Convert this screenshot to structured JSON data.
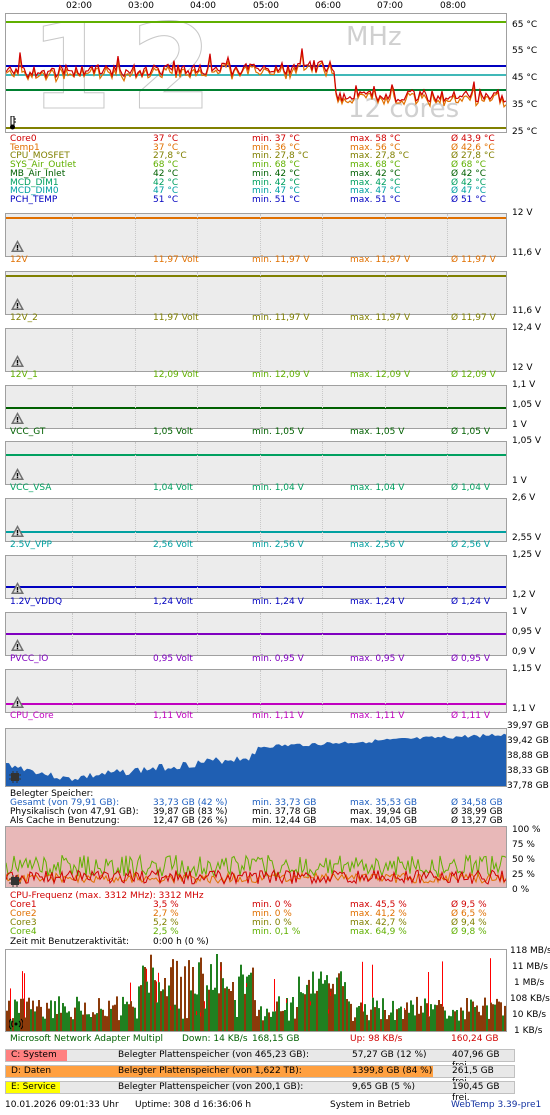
{
  "time_labels": [
    "02:00",
    "03:00",
    "04:00",
    "05:00",
    "06:00",
    "07:00",
    "08:00"
  ],
  "temp_panel": {
    "watermark_left": "12",
    "watermark_mhz": "MHz",
    "watermark_cores": "12 cores",
    "y_labels": [
      "65 °C",
      "55 °C",
      "45 °C",
      "35 °C",
      "25 °C"
    ],
    "rows": [
      {
        "name": "Core0",
        "cur": "37 °C",
        "min": "min. 37 °C",
        "max": "max. 58 °C",
        "avg": "Ø 43,9 °C",
        "color": "#d00000"
      },
      {
        "name": "Temp1",
        "cur": "37 °C",
        "min": "min. 36 °C",
        "max": "max. 56 °C",
        "avg": "Ø 42,6 °C",
        "color": "#e07000"
      },
      {
        "name": "CPU_MOSFET",
        "cur": "27,8 °C",
        "min": "min. 27,8 °C",
        "max": "max. 27,8 °C",
        "avg": "Ø 27,8 °C",
        "color": "#808000"
      },
      {
        "name": "SYS_Air_Outlet",
        "cur": "68 °C",
        "min": "min. 68 °C",
        "max": "max. 68 °C",
        "avg": "Ø 68 °C",
        "color": "#60b000"
      },
      {
        "name": "MB_Air_Inlet",
        "cur": "42 °C",
        "min": "min. 42 °C",
        "max": "max. 42 °C",
        "avg": "Ø 42 °C",
        "color": "#006000"
      },
      {
        "name": "MCD_DIM1",
        "cur": "42 °C",
        "min": "min. 42 °C",
        "max": "max. 42 °C",
        "avg": "Ø 42 °C",
        "color": "#00a060"
      },
      {
        "name": "MCD_DIM0",
        "cur": "47 °C",
        "min": "min. 47 °C",
        "max": "max. 47 °C",
        "avg": "Ø 47 °C",
        "color": "#00a0a0"
      },
      {
        "name": "PCH_TEMP",
        "cur": "51 °C",
        "min": "min. 51 °C",
        "max": "max. 51 °C",
        "avg": "Ø 51 °C",
        "color": "#0000c0"
      }
    ]
  },
  "volt_panels": [
    {
      "name": "12V",
      "cur": "11,97 Volt",
      "min": "min. 11,97 V",
      "max": "max. 11,97 V",
      "avg": "Ø 11,97 V",
      "color": "#e07000",
      "ytop": "12 V",
      "ybot": "11,6 V"
    },
    {
      "name": "12V_2",
      "cur": "11,97 Volt",
      "min": "min. 11,97 V",
      "max": "max. 11,97 V",
      "avg": "Ø 11,97 V",
      "color": "#808000",
      "ytop": "",
      "ybot": "11,6 V"
    },
    {
      "name": "12V_1",
      "cur": "12,09 Volt",
      "min": "min. 12,09 V",
      "max": "max. 12,09 V",
      "avg": "Ø 12,09 V",
      "color": "#60b000",
      "ytop": "12,4 V",
      "ybot": "12 V"
    },
    {
      "name": "VCC_GT",
      "cur": "1,05 Volt",
      "min": "min. 1,05 V",
      "max": "max. 1,05 V",
      "avg": "Ø 1,05 V",
      "color": "#006000",
      "ytop": "1,1 V",
      "ymid": "1,05 V",
      "ybot": "1 V"
    },
    {
      "name": "VCC_VSA",
      "cur": "1,04 Volt",
      "min": "min. 1,04 V",
      "max": "max. 1,04 V",
      "avg": "Ø 1,04 V",
      "color": "#00a060",
      "ytop": "1,05 V",
      "ybot": "1 V"
    },
    {
      "name": "2.5V_VPP",
      "cur": "2,56 Volt",
      "min": "min. 2,56 V",
      "max": "max. 2,56 V",
      "avg": "Ø 2,56 V",
      "color": "#00a0a0",
      "ytop": "2,6 V",
      "ybot": "2,55 V"
    },
    {
      "name": "1.2V_VDDQ",
      "cur": "1,24 Volt",
      "min": "min. 1,24 V",
      "max": "max. 1,24 V",
      "avg": "Ø 1,24 V",
      "color": "#0000c0",
      "ytop": "1,25 V",
      "ybot": "1,2 V"
    },
    {
      "name": "PVCC_IO",
      "cur": "0,95 Volt",
      "min": "min. 0,95 V",
      "max": "max. 0,95 V",
      "avg": "Ø 0,95 V",
      "color": "#8000c0",
      "ytop": "1 V",
      "ymid": "0,95 V",
      "ybot": "0,9 V"
    },
    {
      "name": "CPU_Core",
      "cur": "1,11 Volt",
      "min": "min. 1,11 V",
      "max": "max. 1,11 V",
      "avg": "Ø 1,11 V",
      "color": "#c000c0",
      "ytop": "1,15 V",
      "ybot": "1,1 V"
    }
  ],
  "memory": {
    "y_labels": [
      "39,97 GB",
      "39,42 GB",
      "38,88 GB",
      "38,33 GB",
      "37,78 GB"
    ],
    "title": "Belegter Speicher:",
    "rows": [
      {
        "name": "Gesamt (von 79,91 GB):",
        "cur": "33,73 GB (42 %)",
        "min": "min. 33,73 GB",
        "max": "max. 35,53 GB",
        "avg": "Ø 34,58 GB",
        "color": "#2060c0"
      },
      {
        "name": "Physikalisch (von 47,91 GB):",
        "cur": "39,87 GB (83 %)",
        "min": "min. 37,78 GB",
        "max": "max. 39,94 GB",
        "avg": "Ø 38,99 GB",
        "color": "#000000"
      },
      {
        "name": "Als Cache in Benutzung:",
        "cur": "12,47 GB (26 %)",
        "min": "min. 12,44 GB",
        "max": "max. 14,05 GB",
        "avg": "Ø 13,27 GB",
        "color": "#000000"
      }
    ]
  },
  "cpu": {
    "y_labels": [
      "100 %",
      "75 %",
      "50 %",
      "25 %",
      "0 %"
    ],
    "freq": "CPU-Frequenz (max. 3312 MHz): 3312 MHz",
    "rows": [
      {
        "name": "Core1",
        "cur": "3,5 %",
        "min": "min. 0 %",
        "max": "max. 45,5 %",
        "avg": "Ø 9,5 %",
        "color": "#d00000"
      },
      {
        "name": "Core2",
        "cur": "2,7 %",
        "min": "min. 0 %",
        "max": "max. 41,2 %",
        "avg": "Ø 6,5 %",
        "color": "#e07000"
      },
      {
        "name": "Core3",
        "cur": "5,2 %",
        "min": "min. 0 %",
        "max": "max. 42,7 %",
        "avg": "Ø 9,4 %",
        "color": "#808000"
      },
      {
        "name": "Core4",
        "cur": "2,5 %",
        "min": "min. 0,1 %",
        "max": "max. 64,9 %",
        "avg": "Ø 9,8 %",
        "color": "#60b000"
      }
    ],
    "activity_label": "Zeit mit Benutzeraktivität:",
    "activity_value": "0:00 h (0 %)"
  },
  "network": {
    "y_labels": [
      "118 MB/s",
      "11 MB/s",
      "1 MB/s",
      "108 KB/s",
      "10 KB/s",
      "1 KB/s"
    ],
    "adapter": "Microsoft Network Adapter Multipl",
    "down": "Down: 14 KB/s",
    "down_total": "168,15 GB",
    "up": "Up: 98 KB/s",
    "up_total": "160,24 GB"
  },
  "drives": [
    {
      "label": "C: System",
      "desc": "Belegter Plattenspeicher (von 465,23 GB):",
      "used": "57,27 GB (12 %)",
      "free": "407,96 GB frei.",
      "fraction": 0.12,
      "color": "#ff8080"
    },
    {
      "label": "D: Daten",
      "desc": "Belegter Plattenspeicher (von 1,622 TB):",
      "used": "1399,8 GB (84 %)",
      "free": "261,5 GB frei.",
      "fraction": 0.84,
      "color": "#ffa040"
    },
    {
      "label": "E: Service",
      "desc": "Belegter Plattenspeicher (von 200,1 GB):",
      "used": "9,65 GB (5 %)",
      "free": "190,45 GB frei.",
      "fraction": 0.05,
      "color": "#ffff00"
    }
  ],
  "status_bar": {
    "datetime": "10.01.2026 09:01:33 Uhr",
    "uptime": "Uptime: 308 d 16:36:06 h",
    "state": "System in Betrieb",
    "version": "WebTemp 3.39-pre1"
  }
}
